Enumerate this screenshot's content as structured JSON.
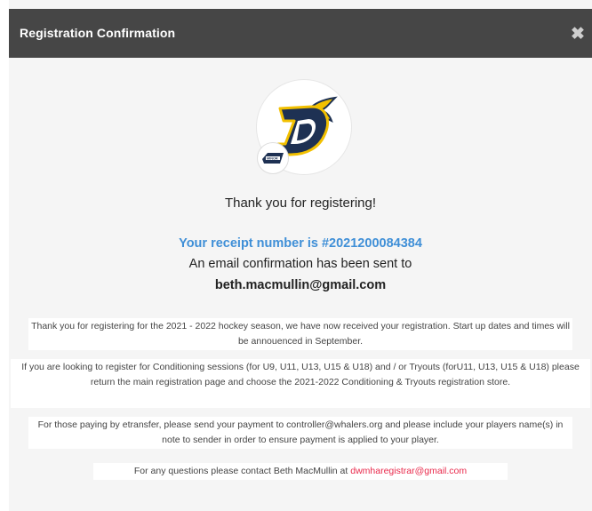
{
  "modal": {
    "title": "Registration Confirmation",
    "close_icon": "close-x-icon"
  },
  "logo": {
    "main_icon": "whalers-d-logo-icon",
    "sub_icon": "minor-hockey-badge-icon",
    "sub_text": "MINOR",
    "colors": {
      "navy": "#1e3153",
      "gold": "#f2c000"
    }
  },
  "confirmation": {
    "thanks": "Thank you for registering!",
    "receipt": "Your receipt number is #2021200084384",
    "email_sent": "An email confirmation has been sent to",
    "email": "beth.macmullin@gmail.com"
  },
  "messages": {
    "season": "Thank you for registering for the 2021 - 2022 hockey season, we have now received your registration.  Start up dates and times will be annouenced in September.",
    "conditioning": "If you are looking to register for Conditioning sessions (for U9, U11, U13, U15 & U18) and / or Tryouts (forU11, U13, U15 & U18) please return the main registration page and choose the 2021-2022 Conditioning & Tryouts registration store.",
    "etransfer": "For those paying by etransfer, please send your payment to controller@whalers.org and please include your players name(s) in note to sender in order to ensure payment is applied to your player.",
    "contact_prefix": "For any questions please contact Beth MacMullin at ",
    "contact_email": "dwmharegistrar@gmail.com"
  },
  "colors": {
    "header_bg": "#464646",
    "receipt_blue": "#3f8fd7",
    "link_red": "#e9294b",
    "body_bg": "#f5f5f5"
  }
}
